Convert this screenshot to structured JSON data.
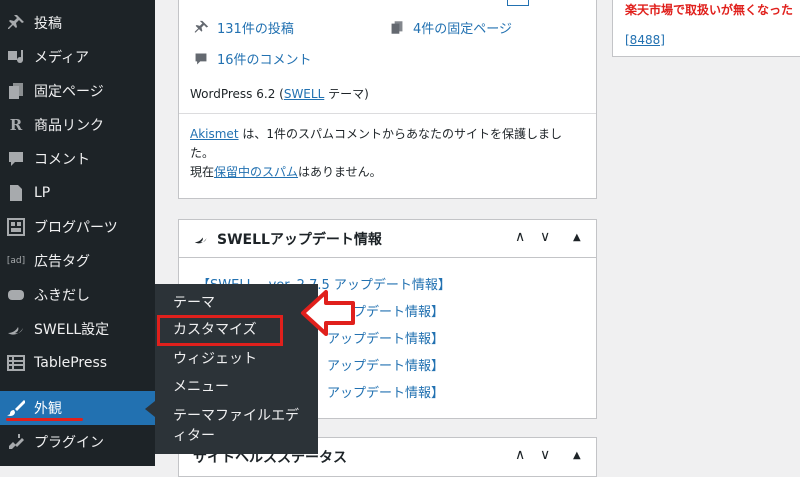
{
  "sidebar": {
    "items": [
      {
        "label": "投稿",
        "icon": "pin-icon"
      },
      {
        "label": "メディア",
        "icon": "media-icon"
      },
      {
        "label": "固定ページ",
        "icon": "page-icon"
      },
      {
        "label": "商品リンク",
        "icon": "r-icon"
      },
      {
        "label": "コメント",
        "icon": "comment-icon"
      },
      {
        "label": "LP",
        "icon": "document-icon"
      },
      {
        "label": "ブログパーツ",
        "icon": "grid-icon"
      },
      {
        "label": "広告タグ",
        "icon": "ad-icon"
      },
      {
        "label": "ふきだし",
        "icon": "bubble-icon"
      },
      {
        "label": "SWELL設定",
        "icon": "swell-icon"
      },
      {
        "label": "TablePress",
        "icon": "table-icon"
      },
      {
        "label": "外観",
        "icon": "brush-icon"
      },
      {
        "label": "プラグイン",
        "icon": "plugin-icon"
      }
    ],
    "ad_icon_text": "[ad]"
  },
  "flyout": {
    "items": [
      "テーマ",
      "カスタマイズ",
      "ウィジェット",
      "メニュー",
      "テーマファイルエディター"
    ]
  },
  "glance": {
    "posts": "131件の投稿",
    "pages": "4件の固定ページ",
    "comments": "16件のコメント",
    "wp_prefix": "WordPress 6.2 (",
    "wp_theme": "SWELL",
    "wp_suffix": " テーマ)",
    "akismet_name": "Akismet",
    "akismet_line1": " は、1件のスパムコメントからあなたのサイトを保護しまし",
    "akismet_line2": "た。",
    "spam_prefix": "現在",
    "spam_link": "保留中のスパム",
    "spam_suffix": "はありません。"
  },
  "swell_box": {
    "title": "SWELLアップデート情報",
    "news": [
      "【SWELL – ver. 2.7.5 アップデート情報】",
      "アップデート情報】",
      "アップデート情報】",
      "アップデート情報】",
      "アップデート情報】"
    ]
  },
  "site_health": {
    "title": "サイトヘルスステータス"
  },
  "right_box": {
    "alert": "楽天市場で取扱いが無くなった",
    "link": "[8488]"
  },
  "controls": {
    "up": "∧",
    "down": "∨",
    "toggle": "▲"
  },
  "colors": {
    "accent": "#2271b1",
    "highlight": "#e0201c",
    "sidebar": "#1d2327",
    "flyout": "#2c3338"
  }
}
